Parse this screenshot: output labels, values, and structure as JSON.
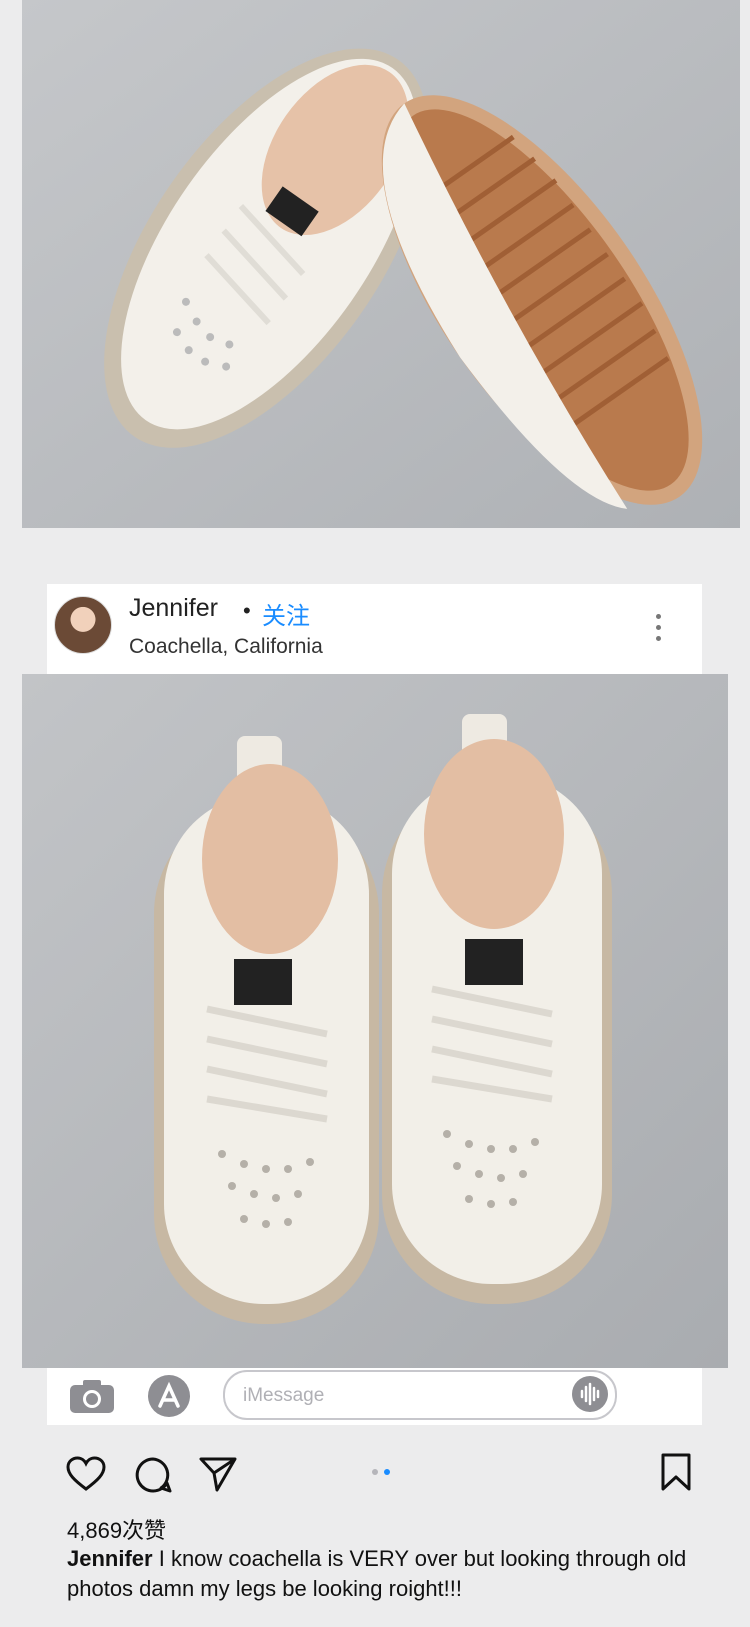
{
  "post": {
    "username": "Jennifer",
    "separator": "•",
    "follow_label": "关注",
    "location": "Coachella, California",
    "more_icon": "more-vertical-icon"
  },
  "imessage_bar": {
    "camera_icon": "camera-icon",
    "appstore_icon": "app-store-icon",
    "placeholder": "iMessage",
    "audio_icon": "audio-wave-icon"
  },
  "actions": {
    "like_icon": "heart-icon",
    "comment_icon": "comment-icon",
    "share_icon": "send-icon",
    "save_icon": "bookmark-icon",
    "pager": {
      "count": 2,
      "active_index": 1
    }
  },
  "likes_text": "4,869次赞",
  "caption": {
    "author": "Jennifer",
    "text": "I know coachella is VERY over but looking through old photos damn my legs be looking roight!!!"
  },
  "colors": {
    "accent": "#1a8cff",
    "background": "#ececed",
    "photo_bg": "#b9bcc0",
    "shoe_white": "#f2efe8",
    "sole_brown": "#b97a4d"
  }
}
